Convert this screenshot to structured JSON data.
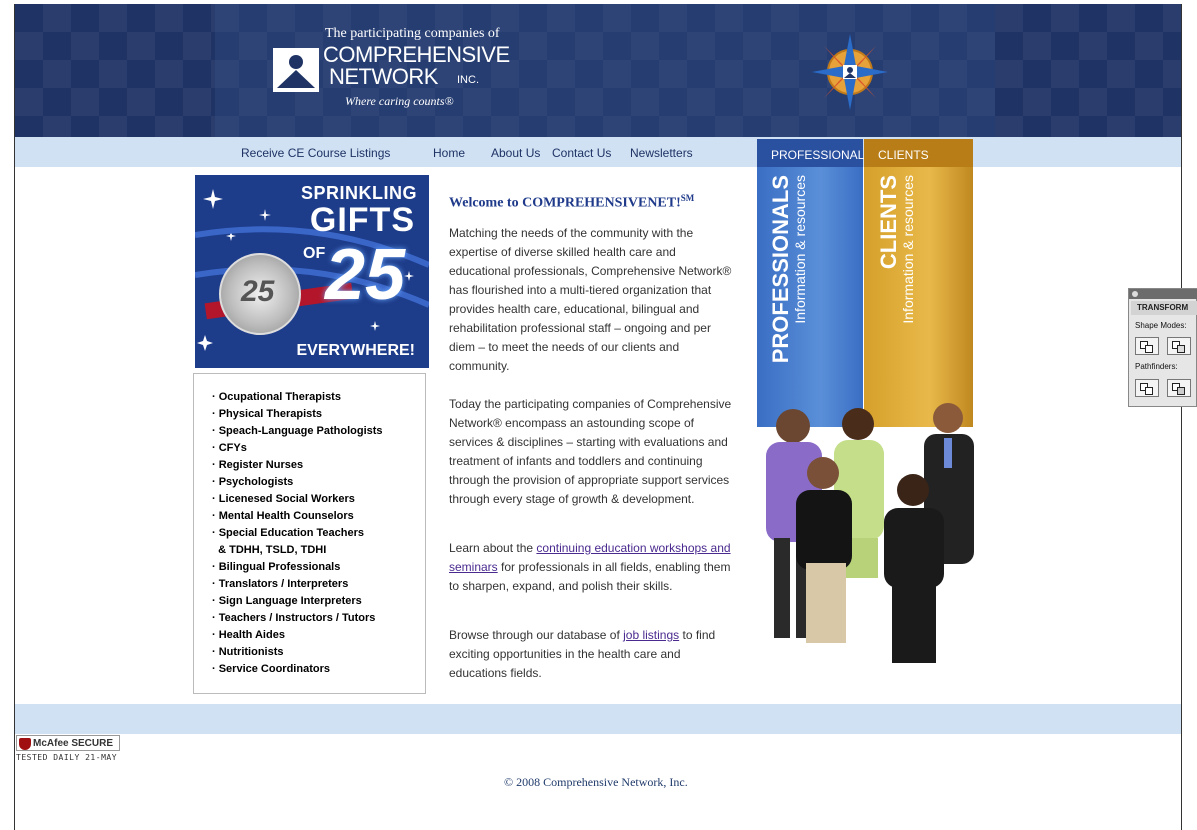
{
  "header": {
    "tagline_top": "The participating companies of",
    "company_line1": "COMPREHENSIVE",
    "company_line2": "NETWORK",
    "company_inc": "INC.",
    "slogan": "Where caring counts®"
  },
  "nav": {
    "ce_label": "Receive CE Course Listings",
    "home_label": "Home",
    "about_label": "About Us",
    "contact_label": "Contact Us",
    "newsletters_label": "Newsletters"
  },
  "side_panel": {
    "professionals_tab": "PROFESSIONALS",
    "clients_tab": "CLIENTS",
    "professionals_big": "PROFESSIONALS",
    "professionals_small": "Information & resources",
    "clients_big": "CLIENTS",
    "clients_small": "Information & resources"
  },
  "promo": {
    "sprinkling": "SPRINKLING",
    "gifts": "GIFTS",
    "of": "OF",
    "number": "25",
    "everywhere": "EVERYWHERE!",
    "seal_number": "25"
  },
  "services": [
    "· Ocupational Therapists",
    "· Physical Therapists",
    "· Speach-Language Pathologists",
    "· CFYs",
    "· Register Nurses",
    "· Psychologists",
    "· Licenesed Social Workers",
    "· Mental Health Counselors",
    "· Special Education Teachers",
    "  & TDHH, TSLD, TDHI",
    "· Bilingual Professionals",
    "· Translators / Interpreters",
    "· Sign Language Interpreters",
    "· Teachers / Instructors / Tutors",
    "· Health Aides",
    "· Nutritionists",
    "· Service Coordinators"
  ],
  "content": {
    "welcome": "Welcome to COMPREHENSIVENET!",
    "welcome_mark": "SM",
    "p1": "Matching the needs of the community with the expertise of diverse skilled health care and educational professionals, Comprehensive Network® has flourished into a multi-tiered organization that provides health care, educational, bilingual and rehabilitation professional staff – ongoing and per diem – to meet the needs of our clients and community.",
    "p2": "Today the participating companies of Comprehensive Network® encompass an astounding scope of services & disciplines – starting with evaluations and treatment of infants and toddlers and continuing through the provision of appropriate support services through every stage of growth & development.",
    "p3_before": "Learn about the ",
    "p3_link": "continuing education workshops and seminars",
    "p3_after": " for professionals in all fields, enabling them to sharpen, expand, and polish their skills.",
    "p4_before": "Browse through our database of ",
    "p4_link": "job listings",
    "p4_after": " to find exciting opportunities in the health care and educations fields."
  },
  "footer": {
    "mcafee_label": "McAfee SECURE",
    "mcafee_tested": "TESTED DAILY  21-MAY",
    "copyright": "© 2008 Comprehensive Network, Inc."
  },
  "transform_panel": {
    "title": "TRANSFORM",
    "shape_modes": "Shape Modes:",
    "pathfinders": "Pathfinders:"
  },
  "colors": {
    "header_bg": "#1f3365",
    "nav_bg": "#cfe1f3",
    "professionals": "#2a50a0",
    "clients": "#b87d16"
  }
}
